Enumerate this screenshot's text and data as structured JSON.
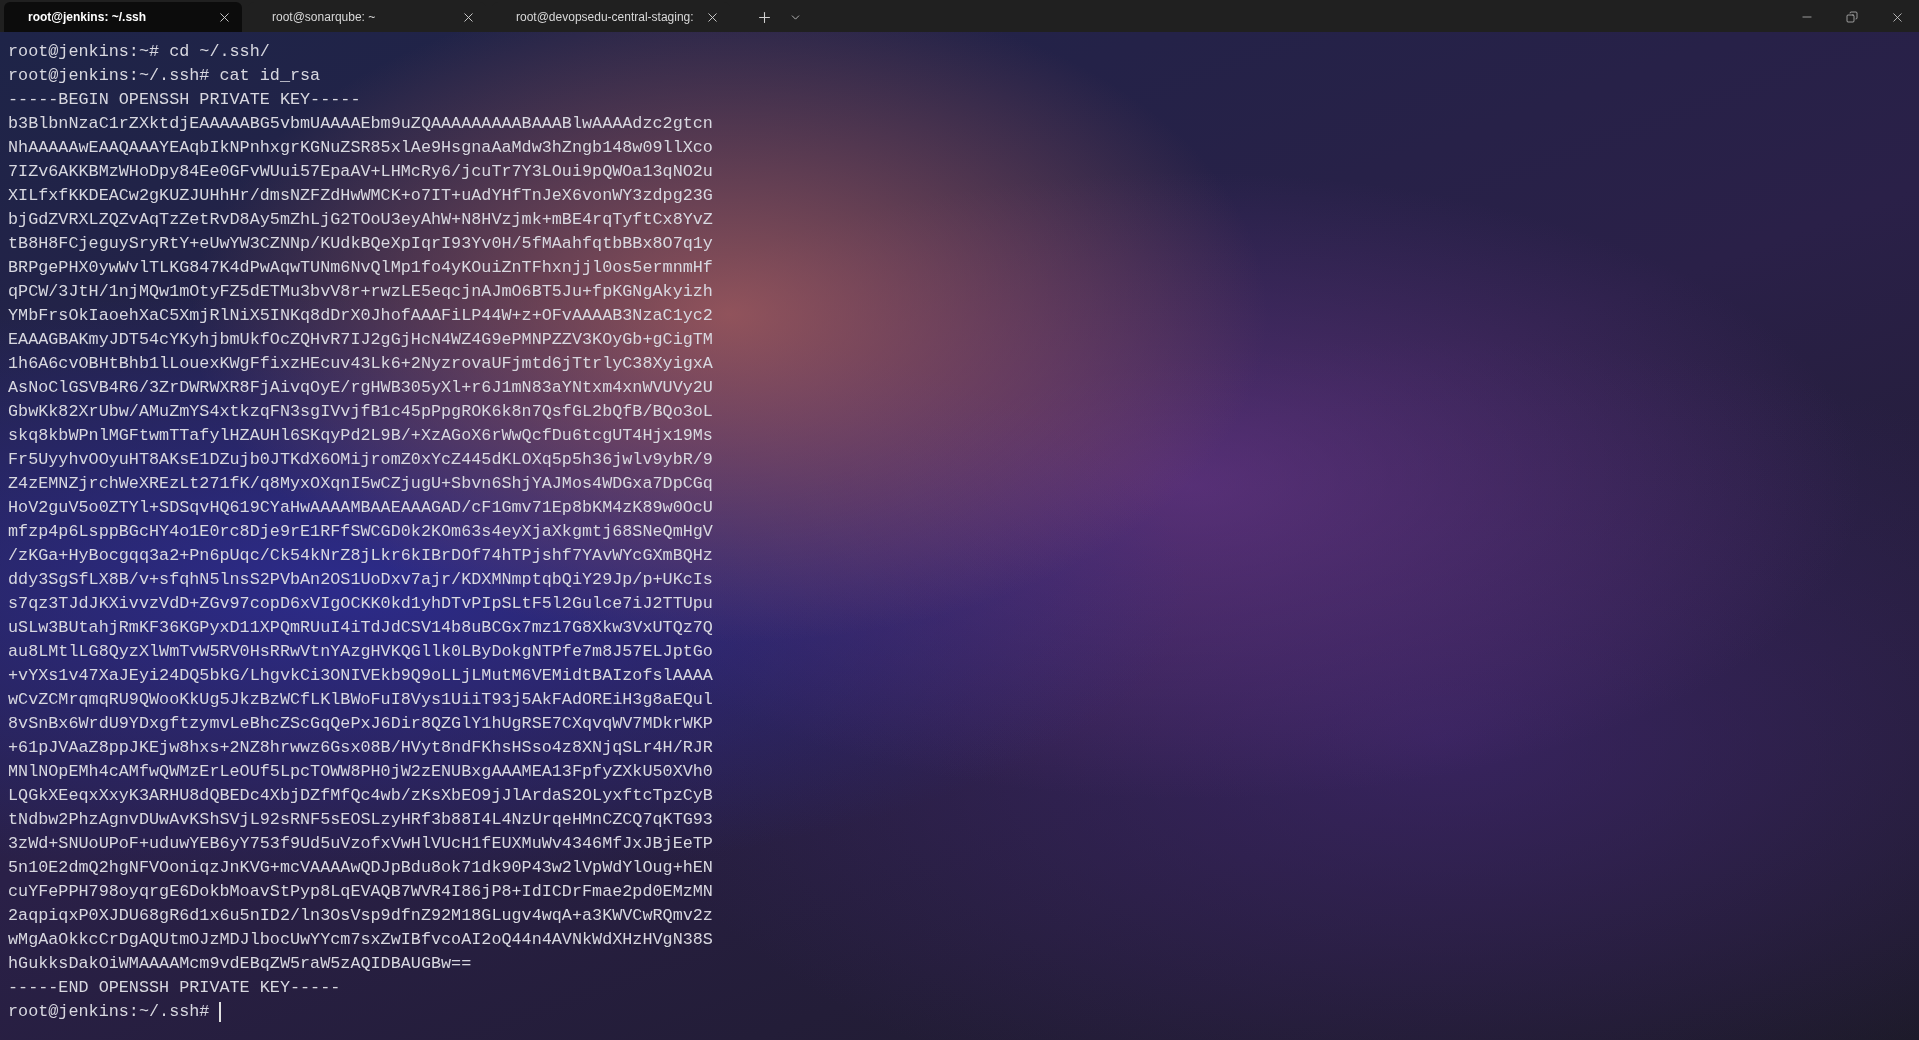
{
  "tabs": [
    {
      "title": "root@jenkins: ~/.ssh",
      "selected": true
    },
    {
      "title": "root@sonarqube: ~",
      "selected": false
    },
    {
      "title": "root@devopsedu-central-staging:",
      "selected": false
    }
  ],
  "terminal": {
    "lines": [
      "root@jenkins:~# cd ~/.ssh/",
      "root@jenkins:~/.ssh# cat id_rsa",
      "-----BEGIN OPENSSH PRIVATE KEY-----",
      "b3BlbnNzaC1rZXktdjEAAAAABG5vbmUAAAAEbm9uZQAAAAAAAAABAAABlwAAAAdzc2gtcn",
      "NhAAAAAwEAAQAAAYEAqbIkNPnhxgrKGNuZSR85xlAe9HsgnaAaMdw3hZngb148w09llXco",
      "7IZv6AKKBMzWHoDpy84Ee0GFvWUui57EpaAV+LHMcRy6/jcuTr7Y3LOui9pQWOa13qNO2u",
      "XILfxfKKDEACw2gKUZJUHhHr/dmsNZFZdHwWMCK+o7IT+uAdYHfTnJeX6vonWY3zdpg23G",
      "bjGdZVRXLZQZvAqTzZetRvD8Ay5mZhLjG2TOoU3eyAhW+N8HVzjmk+mBE4rqTyftCx8YvZ",
      "tB8H8FCjeguySryRtY+eUwYW3CZNNp/KUdkBQeXpIqrI93Yv0H/5fMAahfqtbBBx8O7q1y",
      "BRPgePHX0ywWvlTLKG847K4dPwAqwTUNm6NvQlMp1fo4yKOuiZnTFhxnjjl0os5ermnmHf",
      "qPCW/3JtH/1njMQw1mOtyFZ5dETMu3bvV8r+rwzLE5eqcjnAJmO6BT5Ju+fpKGNgAkyizh",
      "YMbFrsOkIaoehXaC5XmjRlNiX5INKq8dDrX0JhofAAAFiLP44W+z+OFvAAAAB3NzaC1yc2",
      "EAAAGBAKmyJDT54cYKyhjbmUkfOcZQHvR7IJ2gGjHcN4WZ4G9ePMNPZZV3KOyGb+gCigTM",
      "1h6A6cvOBHtBhb1lLouexKWgFfixzHEcuv43Lk6+2NyzrovaUFjmtd6jTtrlyC38XyigxA",
      "AsNoClGSVB4R6/3ZrDWRWXR8FjAivqOyE/rgHWB305yXl+r6J1mN83aYNtxm4xnWVUVy2U",
      "GbwKk82XrUbw/AMuZmYS4xtkzqFN3sgIVvjfB1c45pPpgROK6k8n7QsfGL2bQfB/BQo3oL",
      "skq8kbWPnlMGFtwmTTafylHZAUHl6SKqyPd2L9B/+XzAGoX6rWwQcfDu6tcgUT4Hjx19Ms",
      "Fr5UyyhvOOyuHT8AKsE1DZujb0JTKdX6OMijromZ0xYcZ445dKLOXq5p5h36jwlv9ybR/9",
      "Z4zEMNZjrchWeXREzLt271fK/q8MyxOXqnI5wCZjugU+Sbvn6ShjYAJMos4WDGxa7DpCGq",
      "HoV2guV5o0ZTYl+SDSqvHQ619CYaHwAAAAMBAAEAAAGAD/cF1Gmv71Ep8bKM4zK89w0OcU",
      "mfzp4p6LsppBGcHY4o1E0rc8Dje9rE1RFfSWCGD0k2KOm63s4eyXjaXkgmtj68SNeQmHgV",
      "/zKGa+HyBocgqq3a2+Pn6pUqc/Ck54kNrZ8jLkr6kIBrDOf74hTPjshf7YAvWYcGXmBQHz",
      "ddy3SgSfLX8B/v+sfqhN5lnsS2PVbAn2OS1UoDxv7ajr/KDXMNmptqbQiY29Jp/p+UKcIs",
      "s7qz3TJdJKXivvzVdD+ZGv97copD6xVIgOCKK0kd1yhDTvPIpSLtF5l2Gulce7iJ2TTUpu",
      "uSLw3BUtahjRmKF36KGPyxD11XPQmRUuI4iTdJdCSV14b8uBCGx7mz17G8Xkw3VxUTQz7Q",
      "au8LMtlLG8QyzXlWmTvW5RV0HsRRwVtnYAzgHVKQGllk0LByDokgNTPfe7m8J57ELJptGo",
      "+vYXs1v47XaJEyi24DQ5bkG/LhgvkCi3ONIVEkb9Q9oLLjLMutM6VEMidtBAIzofslAAAA",
      "wCvZCMrqmqRU9QWooKkUg5JkzBzWCfLKlBWoFuI8Vys1UiiT93j5AkFAdOREiH3g8aEQul",
      "8vSnBx6WrdU9YDxgftzymvLeBhcZScGqQePxJ6Dir8QZGlY1hUgRSE7CXqvqWV7MDkrWKP",
      "+61pJVAaZ8ppJKEjw8hxs+2NZ8hrwwz6Gsx08B/HVyt8ndFKhsHSso4z8XNjqSLr4H/RJR",
      "MNlNOpEMh4cAMfwQWMzErLeOUf5LpcTOWW8PH0jW2zENUBxgAAAMEA13FpfyZXkU50XVh0",
      "LQGkXEeqxXxyK3ARHU8dQBEDc4XbjDZfMfQc4wb/zKsXbEO9jJlArdaS2OLyxftcTpzCyB",
      "tNdbw2PhzAgnvDUwAvKShSVjL92sRNF5sEOSLzyHRf3b88I4L4NzUrqeHMnCZCQ7qKTG93",
      "3zWd+SNUoUPoF+uduwYEB6yY753f9Ud5uVzofxVwHlVUcH1fEUXMuWv4346MfJxJBjEeTP",
      "5n10E2dmQ2hgNFVOoniqzJnKVG+mcVAAAAwQDJpBdu8ok71dk90P43w2lVpWdYlOug+hEN",
      "cuYFePPH798oyqrgE6DokbMoavStPyp8LqEVAQB7WVR4I86jP8+IdICDrFmae2pd0EMzMN",
      "2aqpiqxP0XJDU68gR6d1x6u5nID2/ln3OsVsp9dfnZ92M18GLugv4wqA+a3KWVCwRQmv2z",
      "wMgAaOkkcCrDgAQUtmOJzMDJlbocUwYYcm7sxZwIBfvcoAI2oQ44n4AVNkWdXHzHVgN38S",
      "hGukksDakOiWMAAAAMcm9vdEBqZW5raW5zAQIDBAUGBw==",
      "-----END OPENSSH PRIVATE KEY-----",
      "root@jenkins:~/.ssh#"
    ],
    "cursor": true
  }
}
